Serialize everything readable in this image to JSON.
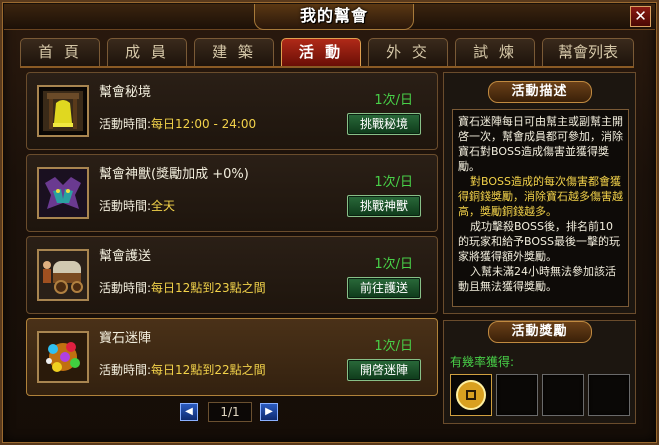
{
  "window": {
    "title": "我的幫會",
    "close": "✕"
  },
  "tabs": [
    {
      "label": "首 頁",
      "active": false
    },
    {
      "label": "成 員",
      "active": false
    },
    {
      "label": "建 築",
      "active": false
    },
    {
      "label": "活 動",
      "active": true
    },
    {
      "label": "外 交",
      "active": false
    },
    {
      "label": "試 煉",
      "active": false
    },
    {
      "label": "幫會列表",
      "active": false
    }
  ],
  "activities": [
    {
      "title": "幫會秘境",
      "time_label": "活動時間:",
      "time": "每日12:00 - 24:00",
      "count": "1次/日",
      "button": "挑戰秘境",
      "icon": "bell-shrine-icon"
    },
    {
      "title": "幫會神獸(獎勵加成 +0%)",
      "time_label": "活動時間:",
      "time": "全天",
      "count": "1次/日",
      "button": "挑戰神獸",
      "icon": "beast-icon"
    },
    {
      "title": "幫會護送",
      "time_label": "活動時間:",
      "time": "每日12點到23點之間",
      "count": "1次/日",
      "button": "前往護送",
      "icon": "wagon-icon"
    },
    {
      "title": "寶石迷陣",
      "time_label": "活動時間:",
      "time": "每日12點到22點之間",
      "count": "1次/日",
      "button": "開啓迷陣",
      "icon": "gems-icon"
    }
  ],
  "pager": {
    "prev": "◀",
    "page": "1/1",
    "next": "▶"
  },
  "description": {
    "header": "活動描述",
    "p1": "寶石迷陣每日可由幫主或副幫主開啓一次，幫會成員都可參加，消除寶石對BOSS造成傷害並獲得獎勵。",
    "p2": "對BOSS造成的每次傷害都會獲得銅錢獎勵，消除寶石越多傷害越高，獎勵銅錢越多。",
    "p3": "成功擊殺BOSS後，排名前10的玩家和給予BOSS最後一擊的玩家將獲得額外獎勵。",
    "p4": "入幫未滿24小時無法參加該活動且無法獲得獎勵。"
  },
  "reward": {
    "header": "活動獎勵",
    "label": "有幾率獲得:",
    "slots": [
      "coin-icon",
      "",
      "",
      ""
    ]
  },
  "colors": {
    "accent_red": "#b02a18",
    "green_text": "#48d048",
    "yellow_text": "#f2d24a"
  }
}
